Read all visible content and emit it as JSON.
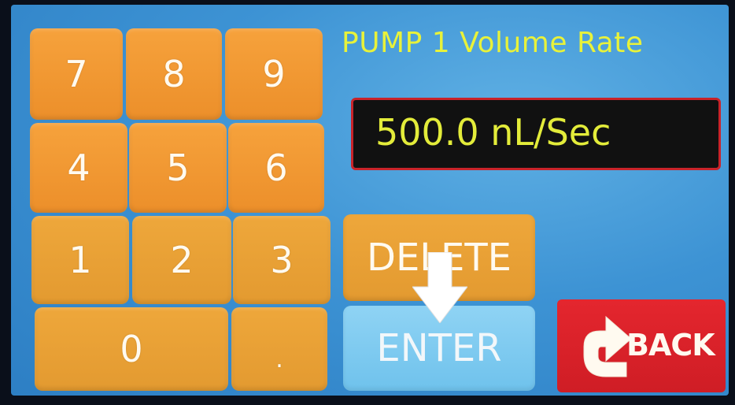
{
  "header": {
    "title": "PUMP 1 Volume Rate"
  },
  "display": {
    "value": "500.0 nL/Sec"
  },
  "keypad": {
    "keys": [
      "7",
      "8",
      "9",
      "4",
      "5",
      "6",
      "1",
      "2",
      "3",
      "0",
      "."
    ]
  },
  "actions": {
    "delete_label": "DELETE",
    "enter_label": "ENTER",
    "back_label": "BACK"
  },
  "colors": {
    "background": "#3d93d4",
    "key": "#ec8f2a",
    "enter": "#6fc2ec",
    "back": "#cf1d25",
    "title_text": "#e8f23a",
    "display_border": "#c8232a"
  },
  "icons": {
    "back": "back-curved-arrow-icon",
    "overlay": "down-arrow-icon"
  }
}
